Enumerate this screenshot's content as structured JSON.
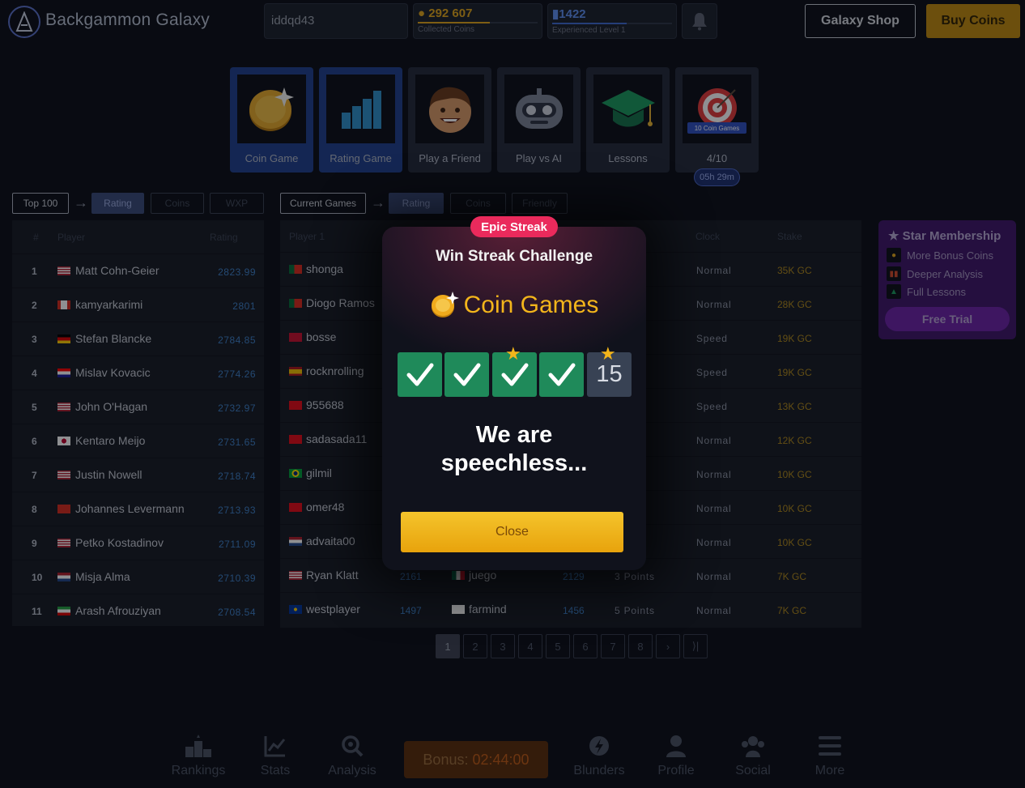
{
  "header": {
    "brand": "Backgammon Galaxy",
    "username": "iddqd43",
    "coins": {
      "value": "292 607",
      "caption": "Collected Coins",
      "progress": 0.6
    },
    "level": {
      "value": "1422",
      "caption": "Experienced Level 1",
      "progress": 0.62
    },
    "shop_label": "Galaxy Shop",
    "buy_label": "Buy Coins",
    "colors": {
      "accent": "#1f3f8c",
      "gold": "#c0890d",
      "rating_blue": "#3d7fc6"
    }
  },
  "modes": [
    {
      "label": "Coin Game",
      "selected": true,
      "icon": "coin-icon"
    },
    {
      "label": "Rating Game",
      "selected": true,
      "icon": "rating-bars-icon"
    },
    {
      "label": "Play a Friend",
      "selected": false,
      "icon": "friend-face-icon"
    },
    {
      "label": "Play vs AI",
      "selected": false,
      "icon": "robot-icon"
    },
    {
      "label": "Lessons",
      "selected": false,
      "icon": "graduation-cap-icon"
    },
    {
      "label": "4/10",
      "selected": false,
      "icon": "target-icon",
      "badge": "10 Coin Games",
      "timer": "05h 29m"
    }
  ],
  "rank_filters": {
    "top": "Top 100",
    "rating": "Rating",
    "coins": "Coins",
    "wxp": "WXP"
  },
  "game_filters": {
    "current": "Current Games",
    "rating": "Rating",
    "coins": "Coins",
    "friendly": "Friendly"
  },
  "rank_table": {
    "headers": {
      "num": "#",
      "player": "Player",
      "rating": "Rating"
    },
    "rows": [
      {
        "num": "1",
        "name": "Matt Cohn-Geier",
        "rating": "2823.99",
        "flag": "us"
      },
      {
        "num": "2",
        "name": "kamyarkarimi",
        "rating": "2801",
        "flag": "ca"
      },
      {
        "num": "3",
        "name": "Stefan Blancke",
        "rating": "2784.85",
        "flag": "de"
      },
      {
        "num": "4",
        "name": "Mislav Kovacic",
        "rating": "2774.26",
        "flag": "hr"
      },
      {
        "num": "5",
        "name": "John O'Hagan",
        "rating": "2732.97",
        "flag": "us"
      },
      {
        "num": "6",
        "name": "Kentaro Meijo",
        "rating": "2731.65",
        "flag": "jp"
      },
      {
        "num": "7",
        "name": "Justin Nowell",
        "rating": "2718.74",
        "flag": "us"
      },
      {
        "num": "8",
        "name": "Johannes Levermann",
        "rating": "2713.93",
        "flag": "ch"
      },
      {
        "num": "9",
        "name": "Petko Kostadinov",
        "rating": "2711.09",
        "flag": "us"
      },
      {
        "num": "10",
        "name": "Misja Alma",
        "rating": "2710.39",
        "flag": "nl"
      },
      {
        "num": "11",
        "name": "Arash Afrouziyan",
        "rating": "2708.54",
        "flag": "ir"
      }
    ]
  },
  "games_table": {
    "headers": {
      "player1": "Player 1",
      "clock": "Clock",
      "stake": "Stake"
    },
    "rows": [
      {
        "p1": "shonga",
        "f1": "pt",
        "r1": "",
        "p2": "",
        "f2": "",
        "r2": "",
        "pts": "ts",
        "clock": "Normal",
        "stake": "35K GC"
      },
      {
        "p1": "Diogo Ramos",
        "f1": "pt",
        "r1": "",
        "p2": "",
        "f2": "",
        "r2": "",
        "pts": "ts",
        "clock": "Normal",
        "stake": "28K GC"
      },
      {
        "p1": "bosse",
        "f1": "dk",
        "r1": "",
        "p2": "",
        "f2": "",
        "r2": "",
        "pts": "ts",
        "clock": "Speed",
        "stake": "19K GC"
      },
      {
        "p1": "rocknrolling",
        "f1": "es",
        "r1": "",
        "p2": "",
        "f2": "",
        "r2": "",
        "pts": "ts",
        "clock": "Speed",
        "stake": "19K GC"
      },
      {
        "p1": "955688",
        "f1": "tr",
        "r1": "",
        "p2": "",
        "f2": "",
        "r2": "",
        "pts": "ts",
        "clock": "Speed",
        "stake": "13K GC"
      },
      {
        "p1": "sadasada11",
        "f1": "tr",
        "r1": "",
        "p2": "",
        "f2": "",
        "r2": "",
        "pts": "ts",
        "clock": "Normal",
        "stake": "12K GC"
      },
      {
        "p1": "gilmil",
        "f1": "br",
        "r1": "",
        "p2": "",
        "f2": "",
        "r2": "",
        "pts": "ts",
        "clock": "Normal",
        "stake": "10K GC"
      },
      {
        "p1": "omer48",
        "f1": "tr",
        "r1": "",
        "p2": "",
        "f2": "",
        "r2": "",
        "pts": "ts",
        "clock": "Normal",
        "stake": "10K GC"
      },
      {
        "p1": "advaita00",
        "f1": "nl",
        "r1": "",
        "p2": "",
        "f2": "",
        "r2": "",
        "pts": "ts",
        "clock": "Normal",
        "stake": "10K GC"
      },
      {
        "p1": "Ryan Klatt",
        "f1": "us",
        "r1": "2161",
        "p2": "juego",
        "f2": "mx",
        "r2": "2129",
        "pts": "3 Points",
        "clock": "Normal",
        "stake": "7K GC"
      },
      {
        "p1": "westplayer",
        "f1": "eu",
        "r1": "1497",
        "p2": "farmind",
        "f2": "fi",
        "r2": "1456",
        "pts": "5 Points",
        "clock": "Normal",
        "stake": "7K GC"
      }
    ]
  },
  "pagination": [
    "1",
    "2",
    "3",
    "4",
    "5",
    "6",
    "7",
    "8",
    "›",
    "⟩|"
  ],
  "membership": {
    "title": "Star Membership",
    "perks": [
      "More Bonus Coins",
      "Deeper Analysis",
      "Full Lessons"
    ],
    "cta": "Free Trial"
  },
  "bottom_nav": {
    "rankings": "Rankings",
    "stats": "Stats",
    "analysis": "Analysis",
    "bonus_label": "Bonus:",
    "bonus_time": "02:44:00",
    "blunders": "Blunders",
    "profile": "Profile",
    "social": "Social",
    "more": "More"
  },
  "modal": {
    "badge": "Epic Streak",
    "title": "Win Streak Challenge",
    "game": "Coin Games",
    "checks": 4,
    "current": "15",
    "message_line1": "We are",
    "message_line2": "speechless...",
    "close": "Close"
  }
}
